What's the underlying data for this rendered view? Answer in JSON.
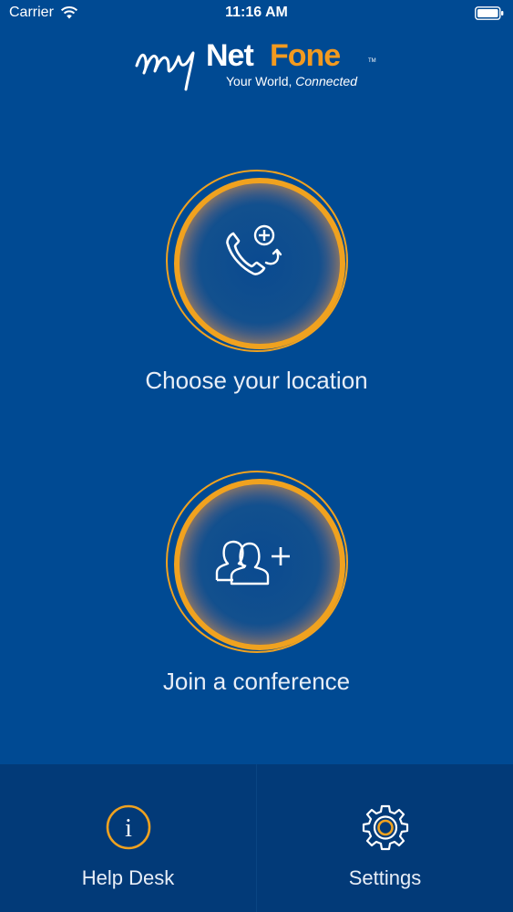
{
  "status_bar": {
    "carrier": "Carrier",
    "time": "11:16 AM"
  },
  "logo": {
    "script": "my",
    "net": "Net",
    "fone": "Fone",
    "tm": "TM",
    "tagline_plain": "Your World, ",
    "tagline_italic": "Connected"
  },
  "actions": {
    "location_label": "Choose your location",
    "conference_label": "Join a conference"
  },
  "toolbar": {
    "help_label": "Help Desk",
    "settings_label": "Settings"
  },
  "colors": {
    "background": "#004a93",
    "accent": "#f0a21f",
    "brand_orange": "#f39a1f",
    "toolbar": "#023a78"
  },
  "icons": {
    "location": "phone-add-icon",
    "conference": "group-add-icon",
    "help": "info-icon",
    "settings": "gear-icon"
  }
}
